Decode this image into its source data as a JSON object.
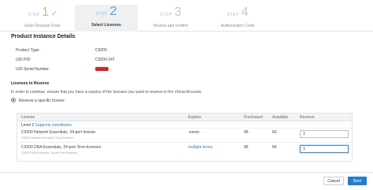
{
  "steps": [
    {
      "word": "STEP",
      "num": "1",
      "label": "Enter Request Code",
      "state": "done"
    },
    {
      "word": "STEP",
      "num": "2",
      "label": "Select Licenses",
      "state": "active"
    },
    {
      "word": "STEP",
      "num": "3",
      "label": "Review and confirm",
      "state": "pending"
    },
    {
      "word": "STEP",
      "num": "4",
      "label": "Authorization Code",
      "state": "pending"
    }
  ],
  "product": {
    "title": "Product Instance Details",
    "type_label": "Product Type:",
    "type_value": "C9200",
    "pid_label": "UDI PID:",
    "pid_value": "C9200-24T",
    "serial_label": "UDI Serial Number:"
  },
  "licenses": {
    "title": "Licenses to Reserve",
    "hint": "In order to continue, ensure that you have a surplus of the licenses you want to reserve in the Virtual Account.",
    "option": "Reserve a specific license"
  },
  "table": {
    "headers": {
      "license": "License",
      "expires": "Expires",
      "purchased": "Purchased",
      "available": "Available",
      "reserve": "Reserve"
    },
    "level_prefix": "Level 2 ",
    "level_link": "Supports substitution",
    "rows": [
      {
        "name": "C9200 Network Essentials, 24-port license",
        "sub": "C9200 Network Essentials, 24-port license",
        "expires": "-never-",
        "purchased": "85",
        "available": "83",
        "reserve": "1"
      },
      {
        "name": "C9200 DNA Essentials, 24-port Term licenses",
        "sub": "C9200 DNA Essentials, 24-port Term licenses",
        "expires": "multiple terms",
        "purchased": "85",
        "available": "84",
        "reserve": "1"
      }
    ]
  },
  "footer": {
    "cancel": "Cancel",
    "next": "Next"
  }
}
